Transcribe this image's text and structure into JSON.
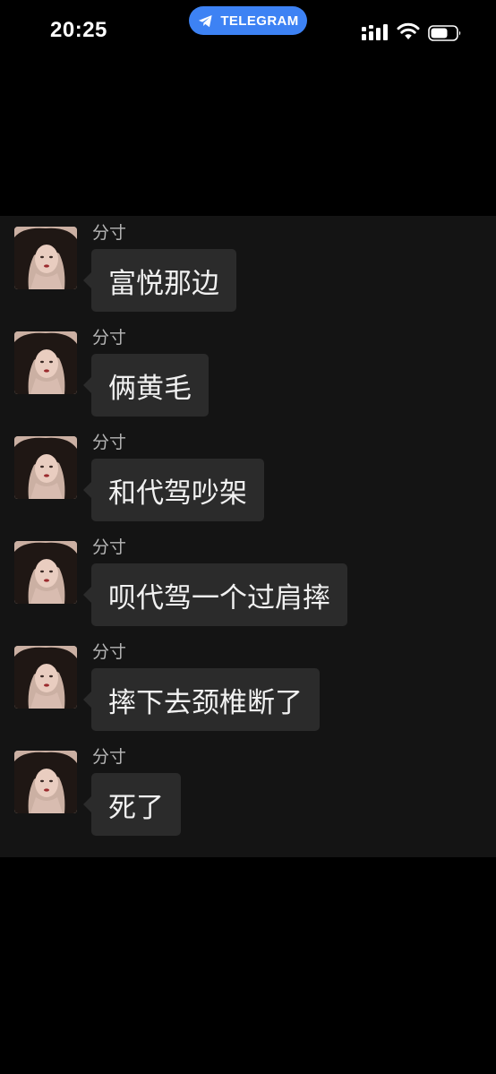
{
  "status_bar": {
    "time": "20:25",
    "source_app": "TELEGRAM",
    "source_color": "#3d82f4",
    "icons": [
      "telegram-icon",
      "cellular-signal-icon",
      "wifi-icon",
      "battery-icon"
    ]
  },
  "chat": {
    "background": "#141414",
    "bubble_color": "#2b2b2b",
    "messages": [
      {
        "sender": "分寸",
        "text": "富悦那边"
      },
      {
        "sender": "分寸",
        "text": "俩黄毛"
      },
      {
        "sender": "分寸",
        "text": "和代驾吵架"
      },
      {
        "sender": "分寸",
        "text": "呗代驾一个过肩摔"
      },
      {
        "sender": "分寸",
        "text": "摔下去颈椎断了"
      },
      {
        "sender": "分寸",
        "text": "死了"
      }
    ]
  }
}
